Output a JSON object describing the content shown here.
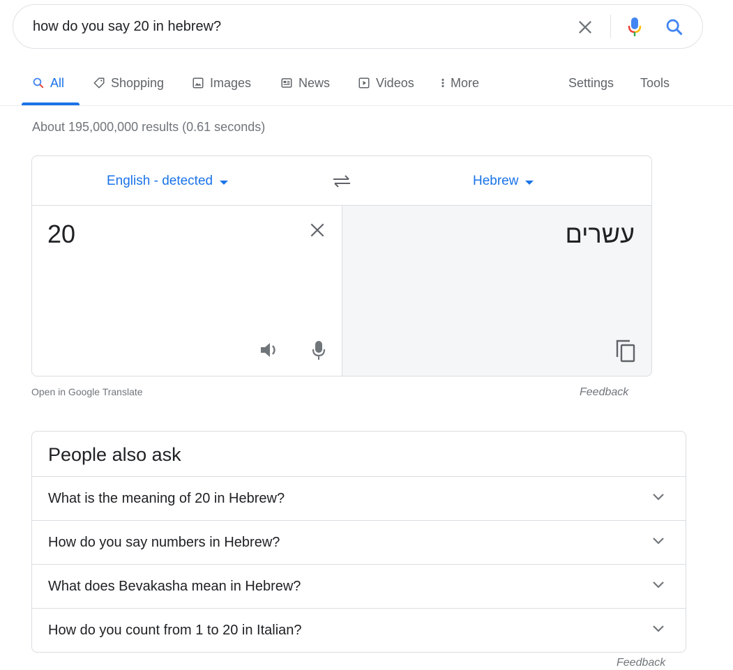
{
  "search": {
    "query": "how do you say 20 in hebrew?",
    "clear_icon": "close-icon",
    "voice_icon": "mic-icon",
    "search_icon": "search-icon"
  },
  "tabs": [
    {
      "label": "All",
      "icon": "search-icon",
      "active": true
    },
    {
      "label": "Shopping",
      "icon": "tag-icon"
    },
    {
      "label": "Images",
      "icon": "image-icon"
    },
    {
      "label": "News",
      "icon": "news-icon"
    },
    {
      "label": "Videos",
      "icon": "play-icon"
    },
    {
      "label": "More",
      "icon": "more-vert-icon"
    }
  ],
  "tools": {
    "settings": "Settings",
    "tools": "Tools"
  },
  "result_stats": "About 195,000,000 results (0.61 seconds)",
  "translate": {
    "source_lang": "English - detected",
    "target_lang": "Hebrew",
    "source_text": "20",
    "target_text": "עשרים",
    "open_link": "Open in Google Translate",
    "feedback": "Feedback"
  },
  "paa": {
    "title": "People also ask",
    "questions": [
      "What is the meaning of 20 in Hebrew?",
      "How do you say numbers in Hebrew?",
      "What does Bevakasha mean in Hebrew?",
      "How do you count from 1 to 20 in Italian?"
    ],
    "feedback": "Feedback"
  },
  "colors": {
    "accent": "#1a73e8",
    "secondary_text": "#70757a",
    "border": "#dadce0",
    "target_pane_bg": "#f5f6f8"
  }
}
